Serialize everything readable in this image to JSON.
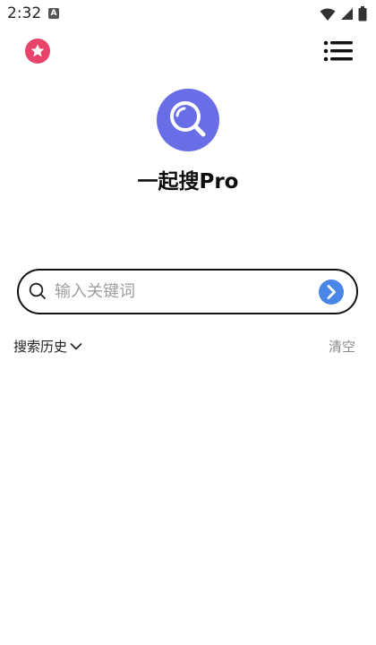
{
  "status_bar": {
    "time": "2:32",
    "notification_badge": "A",
    "icons": [
      "wifi-icon",
      "signal-icon",
      "battery-icon"
    ]
  },
  "top_bar": {
    "favorite_icon": "star-icon",
    "menu_icon": "menu-icon",
    "favorite_color": "#e8436b"
  },
  "header": {
    "logo_icon": "magnifier-logo-icon",
    "logo_color": "#6a6ee6",
    "app_title": "一起搜Pro"
  },
  "search": {
    "placeholder": "输入关键词",
    "value": "",
    "go_icon": "arrow-right-icon",
    "go_color": "#4a86e8"
  },
  "history": {
    "label": "搜索历史",
    "toggle_icon": "chevron-down-icon",
    "clear_label": "清空"
  }
}
